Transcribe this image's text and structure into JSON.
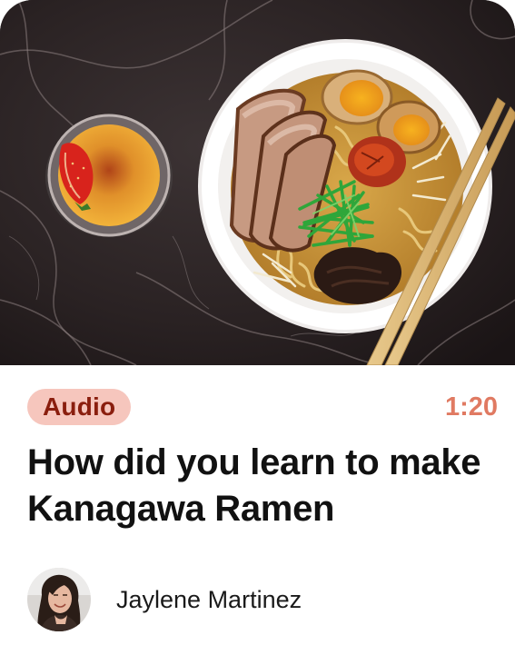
{
  "card": {
    "image_alt": "Ramen bowl with pork, egg, scallions and chopsticks beside a crème brûlée",
    "badge": "Audio",
    "duration": "1:20",
    "title": "How did you learn to make Kanagawa Ramen",
    "author": {
      "name": "Jaylene Martinez"
    }
  },
  "colors": {
    "badge_bg": "#f6c6bd",
    "badge_text": "#8a1e0e",
    "duration": "#e07a62",
    "title": "#111111"
  }
}
